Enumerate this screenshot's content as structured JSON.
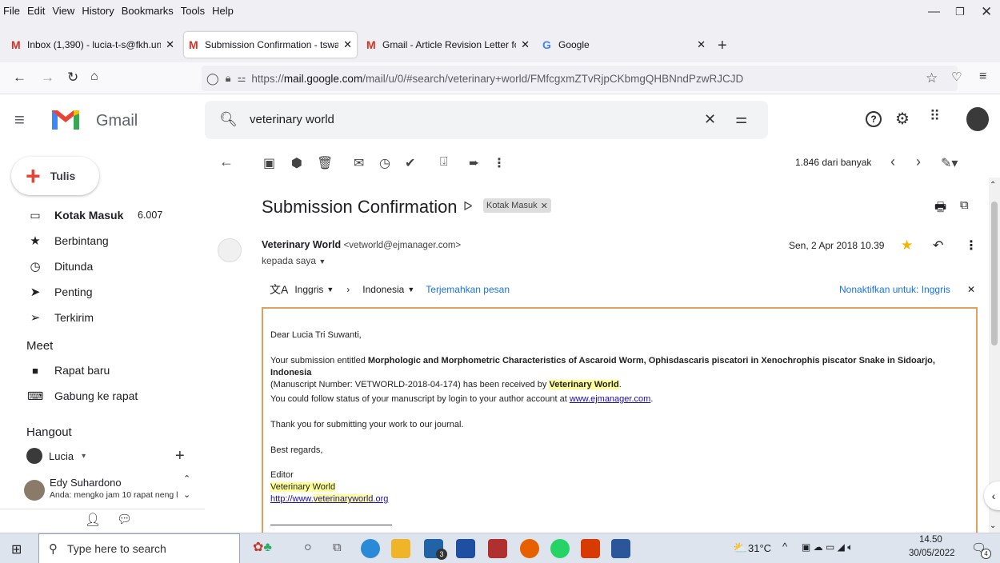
{
  "menubar": {
    "items": [
      "File",
      "Edit",
      "View",
      "History",
      "Bookmarks",
      "Tools",
      "Help"
    ]
  },
  "tabs": [
    {
      "title": "Inbox (1,390) - lucia-t-s@fkh.un",
      "favicon": "gmail-icon"
    },
    {
      "title": "Submission Confirmation - tswa",
      "favicon": "gmail-icon",
      "active": true
    },
    {
      "title": "Gmail - Article Revision Letter fc",
      "favicon": "gmail-icon"
    },
    {
      "title": "Google",
      "favicon": "google-icon"
    }
  ],
  "address": {
    "scheme": "https://",
    "domain": "mail.google.com",
    "path": "/mail/u/0/#search/veterinary+world/FMfcgxmZTvRjpCKbmgQHBNndPzwRJCJD"
  },
  "gmail": {
    "logo_text": "Gmail",
    "search_value": "veterinary world"
  },
  "compose": {
    "label": "Tulis"
  },
  "nav": [
    {
      "label": "Kotak Masuk",
      "count": "6.007",
      "icon": "inbox-icon",
      "bold": true
    },
    {
      "label": "Berbintang",
      "icon": "star-icon"
    },
    {
      "label": "Ditunda",
      "icon": "clock-icon"
    },
    {
      "label": "Penting",
      "icon": "important-icon"
    },
    {
      "label": "Terkirim",
      "icon": "send-icon"
    }
  ],
  "meet": {
    "title": "Meet",
    "items": [
      {
        "label": "Rapat baru",
        "icon": "video-icon"
      },
      {
        "label": "Gabung ke rapat",
        "icon": "keyboard-icon"
      }
    ]
  },
  "hangout": {
    "title": "Hangout",
    "user": "Lucia",
    "contact_name": "Edy Suhardono",
    "contact_snippet": "Anda: mengko jam 10 rapat neng l"
  },
  "toolbar": {
    "pagination": "1.846 dari banyak"
  },
  "email": {
    "subject": "Submission Confirmation",
    "label_chip": "Kotak Masuk",
    "sender_name": "Veterinary World",
    "sender_email": "<vetworld@ejmanager.com>",
    "recipient": "kepada saya",
    "date": "Sen, 2 Apr 2018 10.39",
    "translate": {
      "from": "Inggris",
      "to": "Indonesia",
      "action": "Terjemahkan pesan",
      "disable": "Nonaktifkan untuk: Inggris"
    },
    "body": {
      "greeting": "Dear Lucia Tri Suwanti,",
      "p1_prefix": "Your submission entitled ",
      "p1_title": "Morphologic and Morphometric Characteristics of Ascaroid Worm, Ophisdascaris piscatori in Xenochrophis piscator Snake in Sidoarjo, Indonesia",
      "p1_suffix": "(Manuscript Number: VETWORLD-2018-04-174) has been received by ",
      "p1_journal": "Veterinary World",
      "p2_prefix": "You could follow status of your manuscript by login to your author account at ",
      "p2_link": "www.ejmanager.com",
      "p3": "Thank you for submitting your work to our journal.",
      "p4": "Best regards,",
      "sig_role": "Editor",
      "sig_journal": "Veterinary World",
      "sig_url_prefix": "http://www.",
      "sig_url_hl": "veterinaryworld",
      "sig_url_suffix": ".org"
    }
  },
  "taskbar": {
    "search_placeholder": "Type here to search",
    "weather": "31°C",
    "time": "14.50",
    "date": "30/05/2022",
    "notifications": "4",
    "mail_badge": "3"
  }
}
